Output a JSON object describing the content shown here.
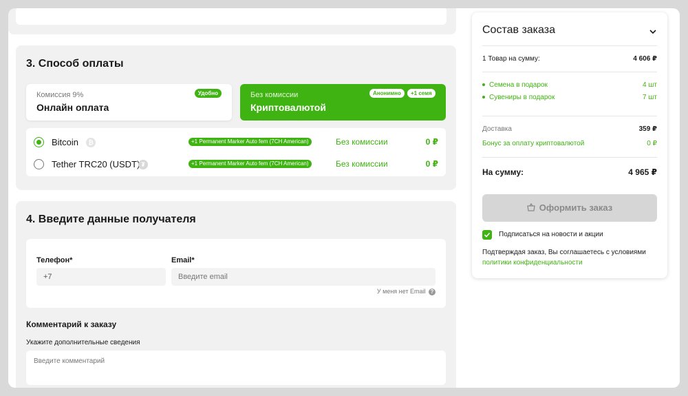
{
  "payment": {
    "heading": "3. Способ оплаты",
    "online": {
      "small": "Комиссия 9%",
      "title": "Онлайн оплата",
      "badge": "Удобно"
    },
    "crypto": {
      "small": "Без комиссии",
      "title": "Криптовалютой",
      "badges": [
        "Анонимно",
        "+1 семя"
      ]
    },
    "coins": [
      {
        "name": "Bitcoin",
        "icon": "bitcoin-icon",
        "selected": true,
        "promo": "+1 Permanent Marker Auto fem (7CH American)",
        "fee": "Без комиссии",
        "amount": "0 ₽"
      },
      {
        "name": "Tether TRC20 (USDT)",
        "icon": "tether-icon",
        "selected": false,
        "promo": "+1 Permanent Marker Auto fem (7CH American)",
        "fee": "Без комиссии",
        "amount": "0 ₽"
      }
    ]
  },
  "recipient": {
    "heading": "4. Введите данные получателя",
    "phone_label": "Телефон*",
    "phone_value": "+7",
    "email_label": "Email*",
    "email_placeholder": "Введите email",
    "no_email": "У меня нет Email",
    "comment_heading": "Комментарий к заказу",
    "comment_label": "Укажите дополнительные сведения",
    "comment_placeholder": "Введите комментарий"
  },
  "summary": {
    "title": "Состав заказа",
    "items_label": "1 Товар на сумму:",
    "items_value": "4 606 ₽",
    "gifts": [
      {
        "label": "Семена в подарок",
        "value": "4 шт"
      },
      {
        "label": "Сувениры в подарок",
        "value": "7 шт"
      }
    ],
    "delivery_label": "Доставка",
    "delivery_value": "359 ₽",
    "bonus_label": "Бонус за оплату криптовалютой",
    "bonus_value": "0 ₽",
    "total_label": "На сумму:",
    "total_value": "4 965 ₽",
    "checkout_button": "Оформить заказ",
    "subscribe_label": "Подписаться на новости и акции",
    "subscribe_checked": true,
    "consent_text": "Подтверждая заказ, Вы соглашаетесь с условиями",
    "consent_link": "политики конфиденциальности"
  },
  "colors": {
    "accent": "#3fb312",
    "card_bg": "#f1f1f1",
    "button_disabled": "#d6d6d6"
  }
}
